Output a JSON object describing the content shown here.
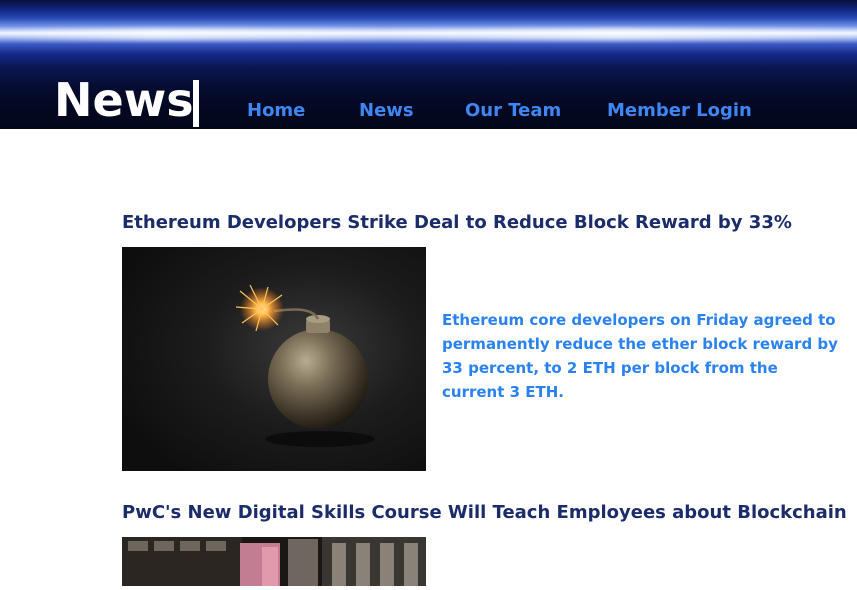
{
  "header": {
    "brand": "News",
    "nav": [
      {
        "label": "Home"
      },
      {
        "label": "News"
      },
      {
        "label": "Our Team"
      },
      {
        "label": "Member Login"
      }
    ]
  },
  "articles": [
    {
      "title": "Ethereum Developers Strike Deal to Reduce Block Reward by 33%",
      "image_icon": "bomb-image",
      "summary": "Ethereum core developers on Friday agreed to permanently reduce the ether block reward by 33 percent, to 2 ETH per block from the current 3 ETH."
    },
    {
      "title": "PwC's New Digital Skills Course Will Teach Employees about Blockchain",
      "image_icon": "office-building-image"
    }
  ]
}
